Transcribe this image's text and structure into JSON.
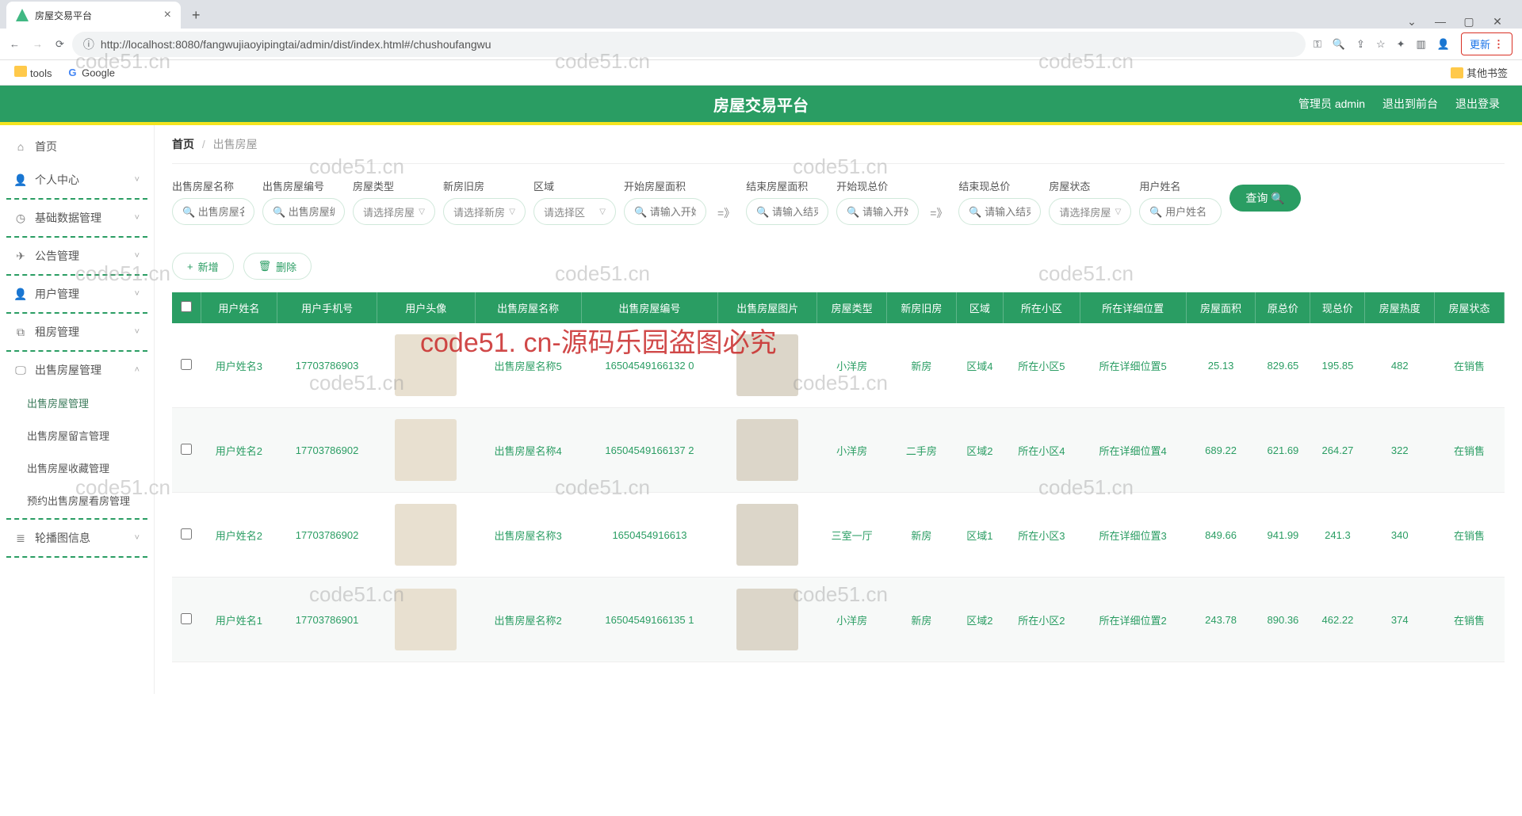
{
  "browser": {
    "tab_title": "房屋交易平台",
    "url": "http://localhost:8080/fangwujiaoyipingtai/admin/dist/index.html#/chushoufangwu",
    "update_label": "更新",
    "bookmarks": {
      "tools": "tools",
      "google": "Google",
      "other": "其他书签"
    }
  },
  "topbar": {
    "title": "房屋交易平台",
    "admin": "管理员 admin",
    "to_front": "退出到前台",
    "logout": "退出登录"
  },
  "sidebar": {
    "items": [
      {
        "label": "首页",
        "icon": "home",
        "type": "item"
      },
      {
        "label": "个人中心",
        "icon": "user",
        "type": "group"
      },
      {
        "label": "基础数据管理",
        "icon": "clock",
        "type": "group"
      },
      {
        "label": "公告管理",
        "icon": "send",
        "type": "group"
      },
      {
        "label": "用户管理",
        "icon": "user",
        "type": "group"
      },
      {
        "label": "租房管理",
        "icon": "copy",
        "type": "group"
      },
      {
        "label": "出售房屋管理",
        "icon": "monitor",
        "type": "group-open",
        "children": [
          "出售房屋管理",
          "出售房屋留言管理",
          "出售房屋收藏管理",
          "预约出售房屋看房管理"
        ]
      },
      {
        "label": "轮播图信息",
        "icon": "list",
        "type": "group"
      }
    ]
  },
  "breadcrumb": {
    "home": "首页",
    "leaf": "出售房屋"
  },
  "filters": [
    {
      "label": "出售房屋名称",
      "placeholder": "出售房屋名",
      "type": "text"
    },
    {
      "label": "出售房屋编号",
      "placeholder": "出售房屋编",
      "type": "text"
    },
    {
      "label": "房屋类型",
      "placeholder": "请选择房屋",
      "type": "select"
    },
    {
      "label": "新房旧房",
      "placeholder": "请选择新房",
      "type": "select"
    },
    {
      "label": "区域",
      "placeholder": "请选择区",
      "type": "select"
    },
    {
      "label": "开始房屋面积",
      "placeholder": "请输入开始",
      "type": "text"
    },
    {
      "label": "结束房屋面积",
      "placeholder": "请输入结束",
      "type": "text"
    },
    {
      "label": "开始现总价",
      "placeholder": "请输入开始",
      "type": "text"
    },
    {
      "label": "结束现总价",
      "placeholder": "请输入结束",
      "type": "text"
    },
    {
      "label": "房屋状态",
      "placeholder": "请选择房屋",
      "type": "select"
    },
    {
      "label": "用户姓名",
      "placeholder": "用户姓名",
      "type": "text"
    }
  ],
  "filter_arrows": "=》",
  "query_btn": "查询",
  "actions": {
    "add": "新增",
    "delete": "删除"
  },
  "columns": [
    "用户姓名",
    "用户手机号",
    "用户头像",
    "出售房屋名称",
    "出售房屋编号",
    "出售房屋图片",
    "房屋类型",
    "新房旧房",
    "区域",
    "所在小区",
    "所在详细位置",
    "房屋面积",
    "原总价",
    "现总价",
    "房屋热度",
    "房屋状态"
  ],
  "rows": [
    {
      "user": "用户姓名3",
      "phone": "17703786903",
      "name": "出售房屋名称5",
      "code": "16504549166132 0",
      "type": "小洋房",
      "newold": "新房",
      "area": "区域4",
      "zone": "所在小区5",
      "pos": "所在详细位置5",
      "sqm": "25.13",
      "orig": "829.65",
      "now": "195.85",
      "heat": "482",
      "status": "在销售"
    },
    {
      "user": "用户姓名2",
      "phone": "17703786902",
      "name": "出售房屋名称4",
      "code": "16504549166137 2",
      "type": "小洋房",
      "newold": "二手房",
      "area": "区域2",
      "zone": "所在小区4",
      "pos": "所在详细位置4",
      "sqm": "689.22",
      "orig": "621.69",
      "now": "264.27",
      "heat": "322",
      "status": "在销售"
    },
    {
      "user": "用户姓名2",
      "phone": "17703786902",
      "name": "出售房屋名称3",
      "code": "1650454916613",
      "type": "三室一厅",
      "newold": "新房",
      "area": "区域1",
      "zone": "所在小区3",
      "pos": "所在详细位置3",
      "sqm": "849.66",
      "orig": "941.99",
      "now": "241.3",
      "heat": "340",
      "status": "在销售"
    },
    {
      "user": "用户姓名1",
      "phone": "17703786901",
      "name": "出售房屋名称2",
      "code": "16504549166135 1",
      "type": "小洋房",
      "newold": "新房",
      "area": "区域2",
      "zone": "所在小区2",
      "pos": "所在详细位置2",
      "sqm": "243.78",
      "orig": "890.36",
      "now": "462.22",
      "heat": "374",
      "status": "在销售"
    }
  ],
  "watermark_text": "code51.cn",
  "watermark_red": "code51. cn-源码乐园盗图必究"
}
